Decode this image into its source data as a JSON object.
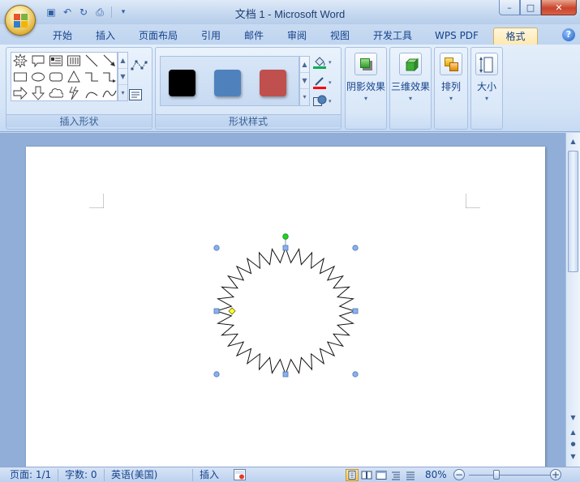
{
  "window": {
    "title": "文档 1 - Microsoft Word",
    "controls": {
      "minimize": "–",
      "maximize": "□",
      "close": "✕"
    }
  },
  "quick_access": [
    {
      "name": "save-icon",
      "glyph": "▣"
    },
    {
      "name": "undo-icon",
      "glyph": "↶"
    },
    {
      "name": "redo-icon",
      "glyph": "↻"
    },
    {
      "name": "print-preview-icon",
      "glyph": "⎙"
    },
    {
      "name": "customize-icon",
      "glyph": "▾"
    }
  ],
  "tabs": [
    {
      "label": "开始"
    },
    {
      "label": "插入"
    },
    {
      "label": "页面布局"
    },
    {
      "label": "引用"
    },
    {
      "label": "邮件"
    },
    {
      "label": "审阅"
    },
    {
      "label": "视图"
    },
    {
      "label": "开发工具"
    },
    {
      "label": "WPS PDF"
    },
    {
      "label": "格式",
      "active": true
    }
  ],
  "help": {
    "glyph": "?"
  },
  "ribbon": {
    "insert_shapes": {
      "label": "插入形状",
      "shapes": [
        "star-burst",
        "callout",
        "text-box",
        "vertical-text-box",
        "line",
        "arrow-line",
        "rectangle",
        "oval",
        "rounded-rectangle",
        "triangle",
        "elbow-connector",
        "curved-connector",
        "right-arrow",
        "down-arrow",
        "cloud",
        "lightning",
        "arc",
        "freeform"
      ],
      "scroll": [
        "▲",
        "▼",
        "▾"
      ]
    },
    "shape_styles": {
      "label": "形状样式",
      "swatches": [
        "#000000",
        "#4f81bd",
        "#c0504d"
      ],
      "scroll": [
        "▲",
        "▼",
        "▾"
      ],
      "launcher": "↘",
      "tools": [
        {
          "name": "fill-color-icon",
          "color": "#00b050"
        },
        {
          "name": "line-color-icon",
          "color": "#ff0000"
        },
        {
          "name": "change-shape-icon",
          "color": "#4f81bd"
        }
      ]
    },
    "buttons": [
      {
        "name": "shadow-effects-button",
        "label": "阴影效果",
        "dd": "▾"
      },
      {
        "name": "3d-effects-button",
        "label": "三维效果",
        "dd": "▾"
      },
      {
        "name": "arrange-button",
        "label": "排列",
        "dd": "▾"
      },
      {
        "name": "size-button",
        "label": "大小",
        "dd": "▾"
      }
    ]
  },
  "document": {
    "shape": {
      "name": "32-point star",
      "points": 32,
      "selected": true
    }
  },
  "scrollbar": {
    "up": "▲",
    "down": "▼",
    "prev": "▲",
    "browse": "●",
    "next": "▼"
  },
  "status": {
    "page": "页面: 1/1",
    "words": "字数: 0",
    "language": "英语(美国)",
    "mode": "插入",
    "zoom": "80%",
    "zoom_out": "−",
    "zoom_in": "+"
  },
  "colors": {
    "ribbon_bg": "#d3e3f6",
    "accent": "#15428b",
    "active_tab": "#ffe9b0"
  }
}
